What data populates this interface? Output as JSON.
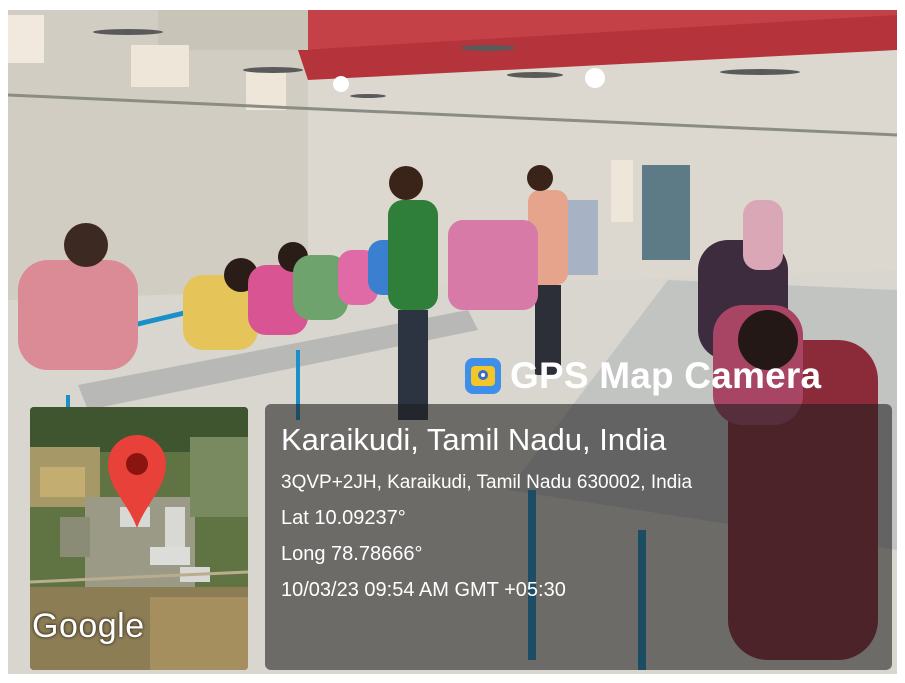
{
  "watermark": {
    "brand": "GPS Map Camera",
    "brand_icon": "map-camera-icon",
    "map_logo": "Google",
    "pin_icon": "location-pin-icon",
    "pin_color": "#e8413a",
    "location_title": "Karaikudi, Tamil Nadu, India",
    "address": "3QVP+2JH, Karaikudi, Tamil Nadu 630002, India",
    "latitude": "Lat 10.09237°",
    "longitude": "Long 78.78666°",
    "timestamp": "10/03/23 09:54 AM GMT +05:30"
  }
}
